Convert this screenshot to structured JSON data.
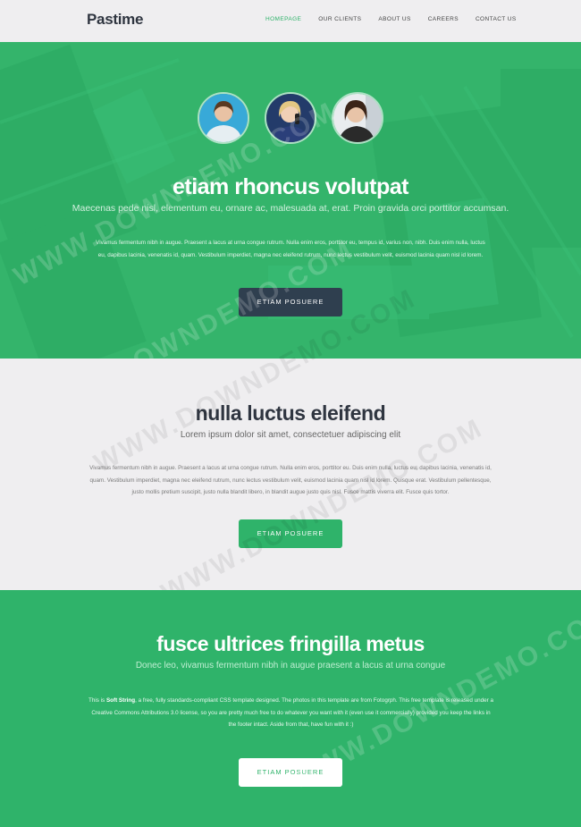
{
  "header": {
    "logo": "Pastime",
    "nav": [
      "Homepage",
      "Our Clients",
      "About Us",
      "Careers",
      "Contact Us"
    ]
  },
  "hero": {
    "title": "etiam rhoncus volutpat",
    "subtitle": "Maecenas pede nisl, elementum eu, ornare ac, malesuada at, erat. Proin gravida orci porttitor accumsan.",
    "body": "Vivamus fermentum nibh in augue. Praesent a lacus at urna congue rutrum. Nulla enim eros, porttitor eu, tempus id, varius non, nibh. Duis enim nulla, luctus eu, dapibus lacinia, venenatis id, quam. Vestibulum imperdiet, magna nec eleifend rutrum, nunc lectus vestibulum velit, euismod lacinia quam nisl id lorem.",
    "button": "Etiam Posuere"
  },
  "section2": {
    "title": "nulla luctus eleifend",
    "subtitle": "Lorem ipsum dolor sit amet, consectetuer adipiscing elit",
    "body": "Vivamus fermentum nibh in augue. Praesent a lacus at urna congue rutrum. Nulla enim eros, porttitor eu. Duis enim nulla, luctus eu, dapibus lacinia, venenatis id, quam. Vestibulum imperdiet, magna nec eleifend rutrum, nunc lectus vestibulum velit, euismod lacinia quam nisl id lorem. Quisque erat. Vestibulum pellentesque, justo mollis pretium suscipit, justo nulla blandit libero, in blandit augue justo quis nisl. Fusce mattis viverra elit. Fusce quis tortor.",
    "button": "Etiam Posuere"
  },
  "section3": {
    "title": "fusce ultrices fringilla metus",
    "subtitle": "Donec leo, vivamus fermentum nibh in augue praesent a lacus at urna congue",
    "body_before": "This is ",
    "body_bold": "Soft String",
    "body_after": ", a free, fully standards-compliant CSS template designed. The photos in this template are from Fotogrph. This free template is released under a Creative Commons Attributions 3.0 license, so you are pretty much free to do whatever you want with it (even use it commercially) provided you keep the links in the footer intact. Aside from that, have fun with it :)",
    "button": "Etiam Posuere"
  },
  "watermark": "WWW.DOWNDEMO.COM",
  "colors": {
    "green": "#2fb36a",
    "dark_button": "#2f3f4f",
    "text_dark": "#2f3540"
  }
}
